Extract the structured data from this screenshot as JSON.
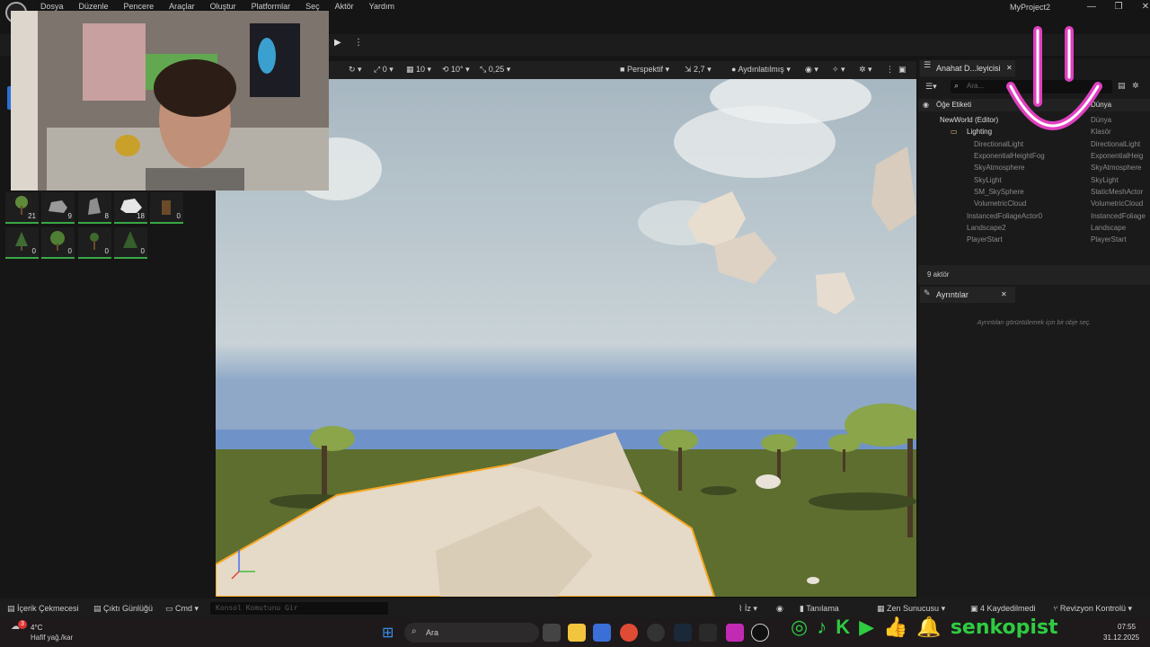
{
  "menu": {
    "items": [
      "Dosya",
      "Düzenle",
      "Pencere",
      "Araçlar",
      "Oluştur",
      "Platformlar",
      "Seç",
      "Aktör",
      "Yardım"
    ],
    "project": "MyProject2"
  },
  "foliage": {
    "counts": [
      "21",
      "9",
      "8",
      "18",
      "0",
      "0",
      "0",
      "0",
      "0"
    ]
  },
  "viewport": {
    "snap_translate": "0",
    "snap_grid": "10",
    "snap_rotate": "10°",
    "snap_scale": "0,25",
    "view_mode": "Perspektif",
    "camera_speed": "2,7",
    "lighting": "Aydınlatılmış"
  },
  "outliner": {
    "tab_title": "Anahat D...leyicisi",
    "search_placeholder": "Ara...",
    "col_label": "Öğe Etiketi",
    "col_type": "Dünya",
    "rows": [
      {
        "name": "NewWorld (Editor)",
        "type": "Dünya"
      },
      {
        "name": "Lighting",
        "type": "Klasör"
      },
      {
        "name": "DirectionalLight",
        "type": "DirectionalLight"
      },
      {
        "name": "ExponentialHeightFog",
        "type": "ExponentialHeig"
      },
      {
        "name": "SkyAtmosphere",
        "type": "SkyAtmosphere"
      },
      {
        "name": "SkyLight",
        "type": "SkyLight"
      },
      {
        "name": "SM_SkySphere",
        "type": "StaticMeshActor"
      },
      {
        "name": "VolumetricCloud",
        "type": "VolumetricCloud"
      },
      {
        "name": "InstancedFoliageActor0",
        "type": "InstancedFoliage"
      },
      {
        "name": "Landscape2",
        "type": "Landscape"
      },
      {
        "name": "PlayerStart",
        "type": "PlayerStart"
      }
    ],
    "actor_count": "9 aktör"
  },
  "details": {
    "tab_title": "Ayrıntılar",
    "empty_msg": "Ayrıntıları görüntülemek için bir obje seç."
  },
  "statusbar": {
    "content_drawer": "İçerik Çekmecesi",
    "output_log": "Çıktı Günlüğü",
    "cmd": "Cmd",
    "console_placeholder": "Konsol Komutunu Gir",
    "trace": "İz",
    "diagnostics": "Tanılama",
    "zen": "Zen Sunucusu",
    "saved": "4 Kaydedilmedi",
    "revision": "Revizyon Kontrolü"
  },
  "taskbar": {
    "temp": "4°C",
    "weather": "Hafif yağ./kar",
    "weather_badge": "3",
    "search": "Ara",
    "time": "07:55",
    "date": "31.12.2025",
    "channel": "senkopist"
  },
  "colors": {
    "accent_green": "#39a845",
    "selection_orange": "#f5a623",
    "overlay_green": "#2ecc40",
    "smile_magenta": "#e040c0"
  }
}
